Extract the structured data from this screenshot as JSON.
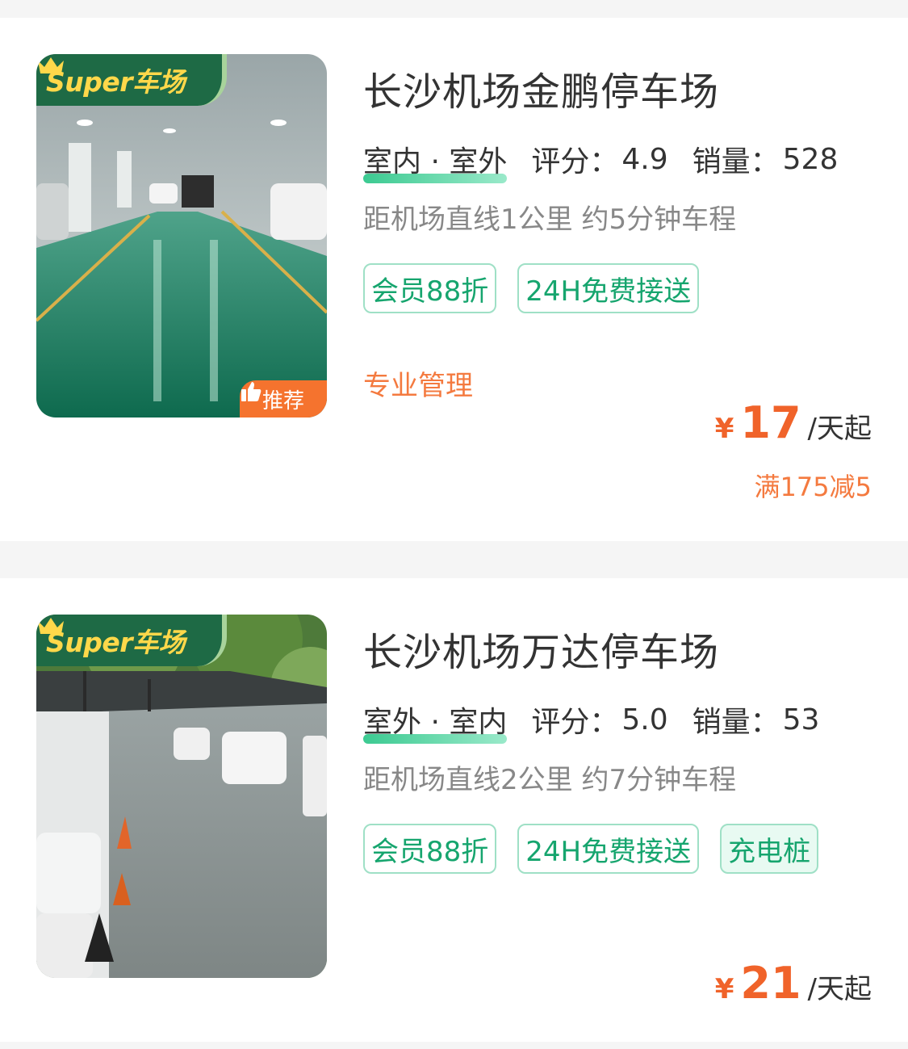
{
  "colors": {
    "accent_green": "#16a56e",
    "accent_orange": "#f0632a",
    "badge_green": "#1e6a45",
    "badge_yellow": "#ffd84a"
  },
  "listings": [
    {
      "badge_text": "Super车场",
      "recommend_label": "推荐",
      "name": "长沙机场金鹏停车场",
      "type": "室内 · 室外",
      "rating_label": "评分：",
      "rating": "4.9",
      "sales_label": "销量：",
      "sales": "528",
      "distance": "距机场直线1公里 约5分钟车程",
      "tags": [
        "会员88折",
        "24H免费接送"
      ],
      "management": "专业管理",
      "currency": "¥",
      "price": "17",
      "price_unit": "/天起",
      "promo": "满175减5"
    },
    {
      "badge_text": "Super车场",
      "name": "长沙机场万达停车场",
      "type": "室外 · 室内",
      "rating_label": "评分：",
      "rating": "5.0",
      "sales_label": "销量：",
      "sales": "53",
      "distance": "距机场直线2公里 约7分钟车程",
      "tags": [
        "会员88折",
        "24H免费接送",
        "充电桩"
      ],
      "currency": "¥",
      "price": "21",
      "price_unit": "/天起"
    }
  ]
}
